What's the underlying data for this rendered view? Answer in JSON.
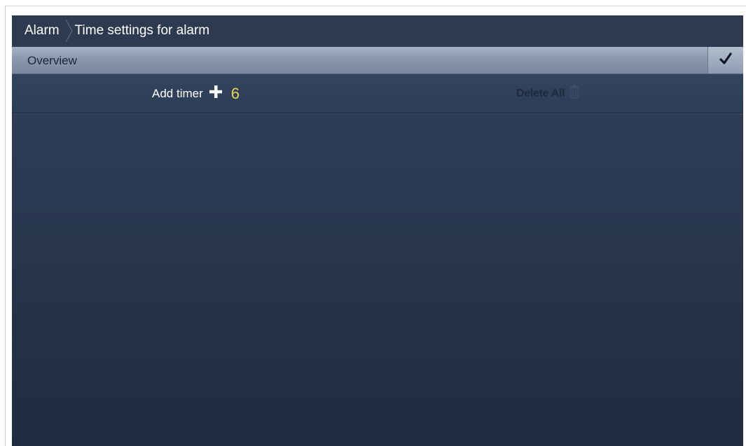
{
  "breadcrumb": {
    "root": "Alarm",
    "current": "Time settings for alarm"
  },
  "overview": {
    "title": "Overview",
    "confirm_icon": "checkmark-icon"
  },
  "actions": {
    "add_timer_label": "Add timer",
    "add_icon": "plus-icon",
    "timer_count": "6",
    "delete_all_label": "Delete All",
    "delete_icon": "trash-icon"
  },
  "colors": {
    "accent_count": "#f0d24a",
    "header_bar": "#8998ae",
    "background": "#2a3a52"
  }
}
